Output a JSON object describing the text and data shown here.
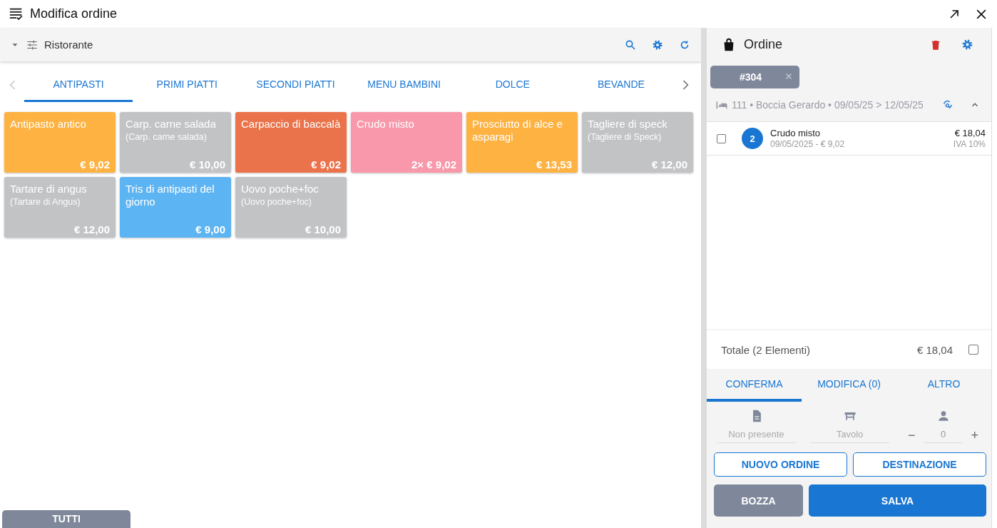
{
  "window": {
    "title": "Modifica ordine"
  },
  "menu": {
    "filter_label": "Ristorante",
    "categories": [
      {
        "label": "ANTIPASTI",
        "selected": true
      },
      {
        "label": "PRIMI PIATTI",
        "selected": false
      },
      {
        "label": "SECONDI PIATTI",
        "selected": false
      },
      {
        "label": "MENU BAMBINI",
        "selected": false
      },
      {
        "label": "DOLCE",
        "selected": false
      },
      {
        "label": "BEVANDE",
        "selected": false
      }
    ],
    "products": [
      {
        "name": "Antipasto antico",
        "price": "€ 9,02",
        "color": "#fdb242"
      },
      {
        "name": "Carp. carne salada",
        "subtitle": "(Carp. carne salada)",
        "price": "€ 10,00",
        "color": "#c2c3c5"
      },
      {
        "name": "Carpaccio di baccalà",
        "price": "€ 9,02",
        "color": "#ea734b"
      },
      {
        "name": "Crudo misto",
        "price": "2× € 9,02",
        "color": "#f898aa"
      },
      {
        "name": "Prosciutto di alce e asparagi",
        "price": "€ 13,53",
        "color": "#fdb242"
      },
      {
        "name": "Tagliere di speck",
        "subtitle": "(Tagliere di Speck)",
        "price": "€ 12,00",
        "color": "#c2c3c5"
      },
      {
        "name": "Tartare di angus",
        "subtitle": "(Tartare di Angus)",
        "price": "€ 12,00",
        "color": "#c2c3c5"
      },
      {
        "name": "Tris di antipasti del giorno",
        "price": "€ 9,00",
        "color": "#5db4f2"
      },
      {
        "name": "Uovo poche+foc",
        "subtitle": "(Uovo poche+foc)",
        "price": "€ 10,00",
        "color": "#c2c3c5"
      }
    ],
    "all_button": "TUTTI"
  },
  "order": {
    "title": "Ordine",
    "order_chip": "#304",
    "booking": "111 • Boccia Gerardo • 09/05/25 > 12/05/25",
    "items": [
      {
        "quantity": "2",
        "name": "Crudo misto",
        "detail": "09/05/2025 - € 9,02",
        "price": "€ 18,04",
        "vat": "IVA 10%",
        "checked": false
      }
    ],
    "total_label": "Totale (2 Elementi)",
    "total": "€ 18,04",
    "total_checked": false,
    "action_tabs": [
      {
        "label": "CONFERMA",
        "selected": true
      },
      {
        "label": "MODIFICA (0)",
        "selected": false
      },
      {
        "label": "ALTRO",
        "selected": false
      }
    ],
    "fields": [
      {
        "kind": "note",
        "placeholder": "Non presente"
      },
      {
        "kind": "table",
        "placeholder": "Tavolo"
      },
      {
        "kind": "guests",
        "value": "0",
        "minus": "−",
        "plus": "+"
      }
    ],
    "buttons": [
      {
        "label": "NUOVO ORDINE",
        "kind": "outline"
      },
      {
        "label": "DESTINAZIONE",
        "kind": "outline"
      },
      {
        "label": "BOZZA",
        "kind": "muted"
      },
      {
        "label": "SALVA",
        "kind": "primary"
      }
    ]
  }
}
